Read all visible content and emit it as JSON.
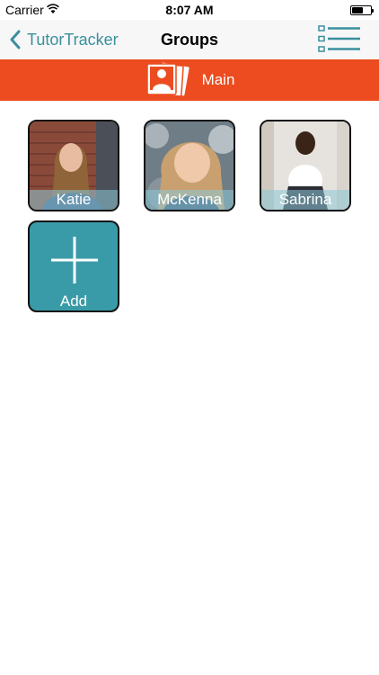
{
  "status_bar": {
    "carrier": "Carrier",
    "time": "8:07 AM"
  },
  "nav": {
    "back_label": "TutorTracker",
    "title": "Groups",
    "menu_icon": "list-menu-icon"
  },
  "banner": {
    "label": "Main",
    "icon": "photos-icon",
    "color": "#ec4c1f"
  },
  "accent_color": "#3a8f9e",
  "students": [
    {
      "name": "Katie"
    },
    {
      "name": "McKenna"
    },
    {
      "name": "Sabrina"
    }
  ],
  "add_tile": {
    "label": "Add",
    "color": "#3a9ba8"
  }
}
